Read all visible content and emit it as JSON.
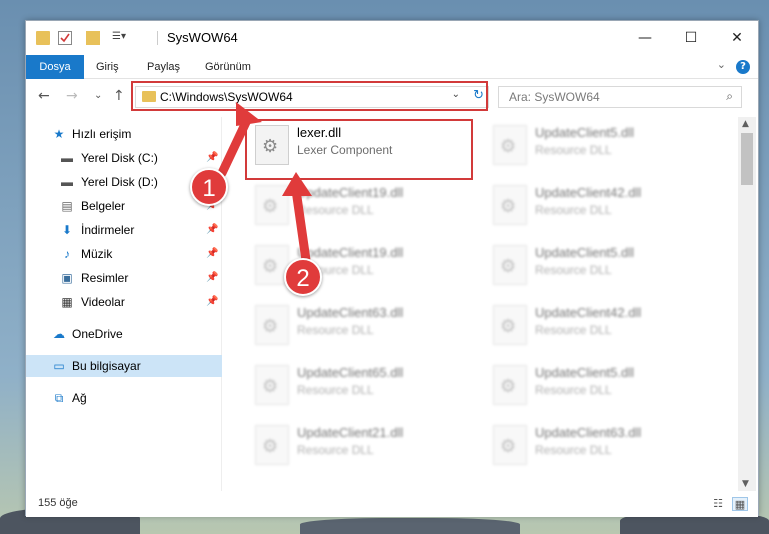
{
  "window": {
    "title": "SysWOW64",
    "controls": {
      "minimize": "—",
      "maximize": "☐",
      "close": "✕"
    }
  },
  "ribbon": {
    "tabs": [
      "Dosya",
      "Giriş",
      "Paylaş",
      "Görünüm"
    ],
    "help": "?",
    "collapse": "⌄"
  },
  "nav": {
    "back": "←",
    "forward": "→",
    "recent": "⌄",
    "up": "↑",
    "address": "C:\\Windows\\SysWOW64",
    "address_dropdown": "⌄",
    "refresh": "↻",
    "search_placeholder": "Ara: SysWOW64",
    "search_icon": "⌕"
  },
  "sidebar": {
    "items": [
      {
        "label": "Hızlı erişim",
        "icon": "★",
        "pinned": false
      },
      {
        "label": "Yerel Disk (C:)",
        "icon": "▬",
        "pinned": true
      },
      {
        "label": "Yerel Disk (D:)",
        "icon": "▬",
        "pinned": true
      },
      {
        "label": "Belgeler",
        "icon": "▤",
        "pinned": true
      },
      {
        "label": "İndirmeler",
        "icon": "⬇",
        "pinned": true
      },
      {
        "label": "Müzik",
        "icon": "♪",
        "pinned": true
      },
      {
        "label": "Resimler",
        "icon": "▣",
        "pinned": true
      },
      {
        "label": "Videolar",
        "icon": "▦",
        "pinned": true
      },
      {
        "label": "OneDrive",
        "icon": "☁",
        "pinned": false
      },
      {
        "label": "Bu bilgisayar",
        "icon": "▭",
        "pinned": false
      },
      {
        "label": "Ağ",
        "icon": "⧉",
        "pinned": false
      }
    ],
    "pin_glyph": "📌"
  },
  "files": [
    {
      "name": "lexer.dll",
      "desc": "Lexer Component"
    },
    {
      "name": "UpdateClient5.dll",
      "desc": "Resource DLL"
    },
    {
      "name": "UpdateClient19.dll",
      "desc": "Resource DLL"
    },
    {
      "name": "UpdateClient42.dll",
      "desc": "Resource DLL"
    },
    {
      "name": "UpdateClient19.dll",
      "desc": "Resource DLL"
    },
    {
      "name": "UpdateClient5.dll",
      "desc": "Resource DLL"
    },
    {
      "name": "UpdateClient63.dll",
      "desc": "Resource DLL"
    },
    {
      "name": "UpdateClient42.dll",
      "desc": "Resource DLL"
    },
    {
      "name": "UpdateClient65.dll",
      "desc": "Resource DLL"
    },
    {
      "name": "UpdateClient5.dll",
      "desc": "Resource DLL"
    },
    {
      "name": "UpdateClient21.dll",
      "desc": "Resource DLL"
    },
    {
      "name": "UpdateClient63.dll",
      "desc": "Resource DLL"
    }
  ],
  "status": {
    "count": "155 öğe"
  },
  "annotations": {
    "step1": "1",
    "step2": "2",
    "color": "#e03b3b"
  },
  "colors": {
    "accent": "#1979ca",
    "folder": "#e8c15a",
    "highlight": "#d23a3a"
  }
}
